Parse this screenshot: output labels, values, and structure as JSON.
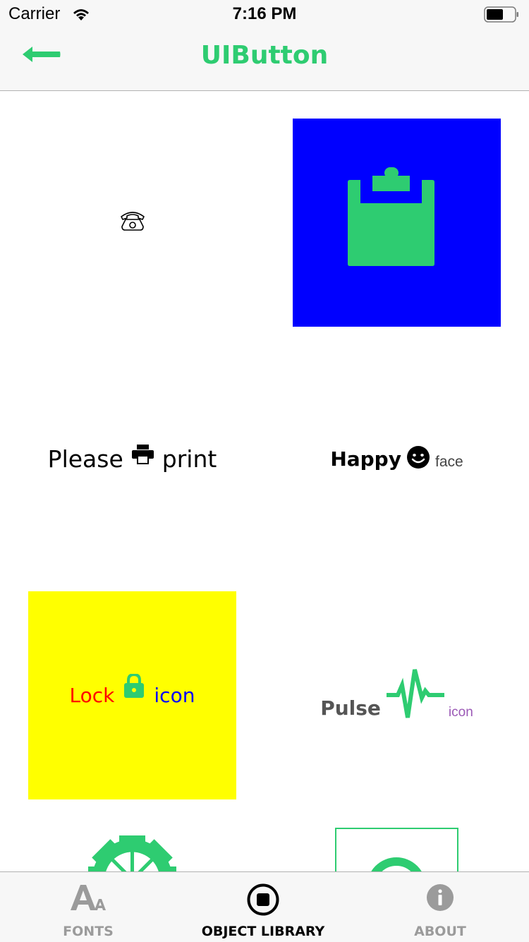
{
  "status_bar": {
    "carrier": "Carrier",
    "time": "7:16 PM"
  },
  "nav": {
    "title": "UIButton",
    "back_icon": "arrow-left-icon"
  },
  "colors": {
    "accent": "#2ecc71",
    "blue": "#0000ff",
    "yellow": "#ffff00",
    "red": "#ff0000",
    "purple": "#9b59b6",
    "gray_text": "#555555"
  },
  "buttons": {
    "phone": {
      "icon": "phone-icon"
    },
    "clipboard": {
      "icon": "clipboard-icon"
    },
    "print": {
      "before": "Please",
      "icon": "print-icon",
      "after": "print"
    },
    "happy": {
      "before": "Happy",
      "icon": "smile-icon",
      "after": "face"
    },
    "lock": {
      "before": "Lock",
      "icon": "lock-icon",
      "after": "icon"
    },
    "pulse": {
      "before": "Pulse",
      "icon": "pulse-icon",
      "after": "icon"
    },
    "gear": {
      "icon": "gear-icon"
    },
    "box": {
      "icon": "circle-icon"
    }
  },
  "tabs": [
    {
      "label": "FONTS",
      "icon": "font-icon",
      "selected": false
    },
    {
      "label": "OBJECT LIBRARY",
      "icon": "stop-circle-icon",
      "selected": true
    },
    {
      "label": "ABOUT",
      "icon": "info-icon",
      "selected": false
    }
  ]
}
